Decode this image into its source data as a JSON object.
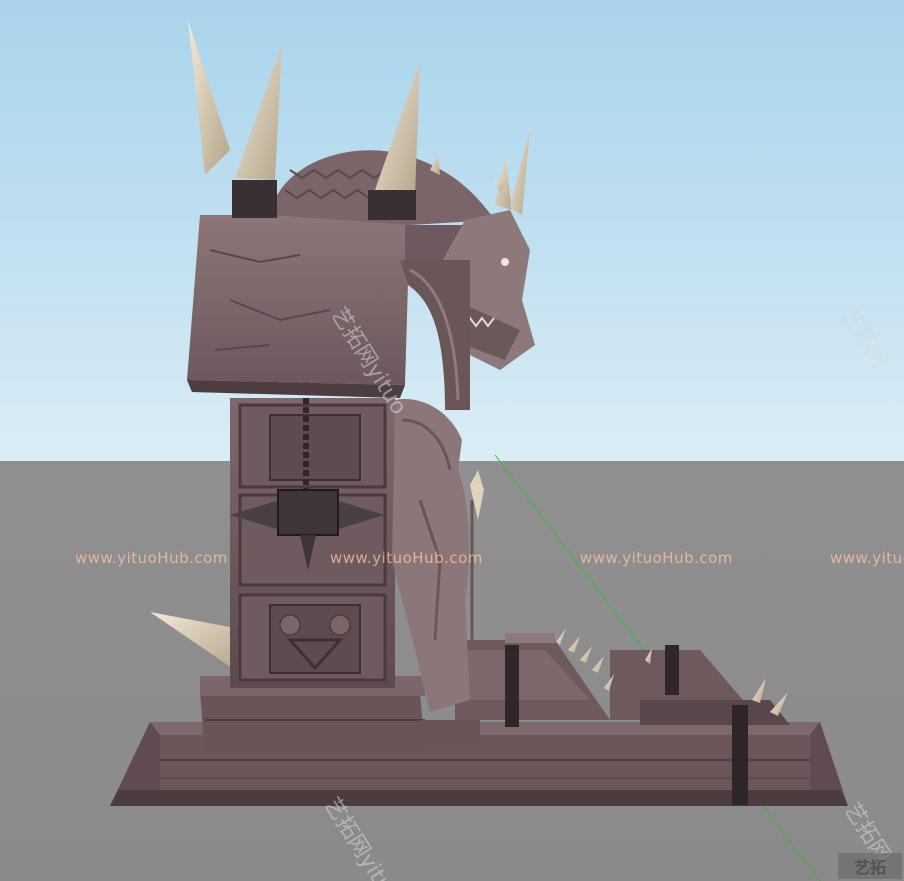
{
  "scene": {
    "subject": "",
    "sky_color": "#b6dbef",
    "ground_color": "#8e8e8e",
    "stone_color": "#7a6468",
    "horn_color": "#e3d6bf",
    "axis_green": "#3cb43c"
  },
  "watermarks": {
    "site_text": "www.yituoHub.com",
    "cn_text": "艺拓网yituo",
    "cn_short": "艺拓网",
    "logo_text": "艺拓"
  }
}
